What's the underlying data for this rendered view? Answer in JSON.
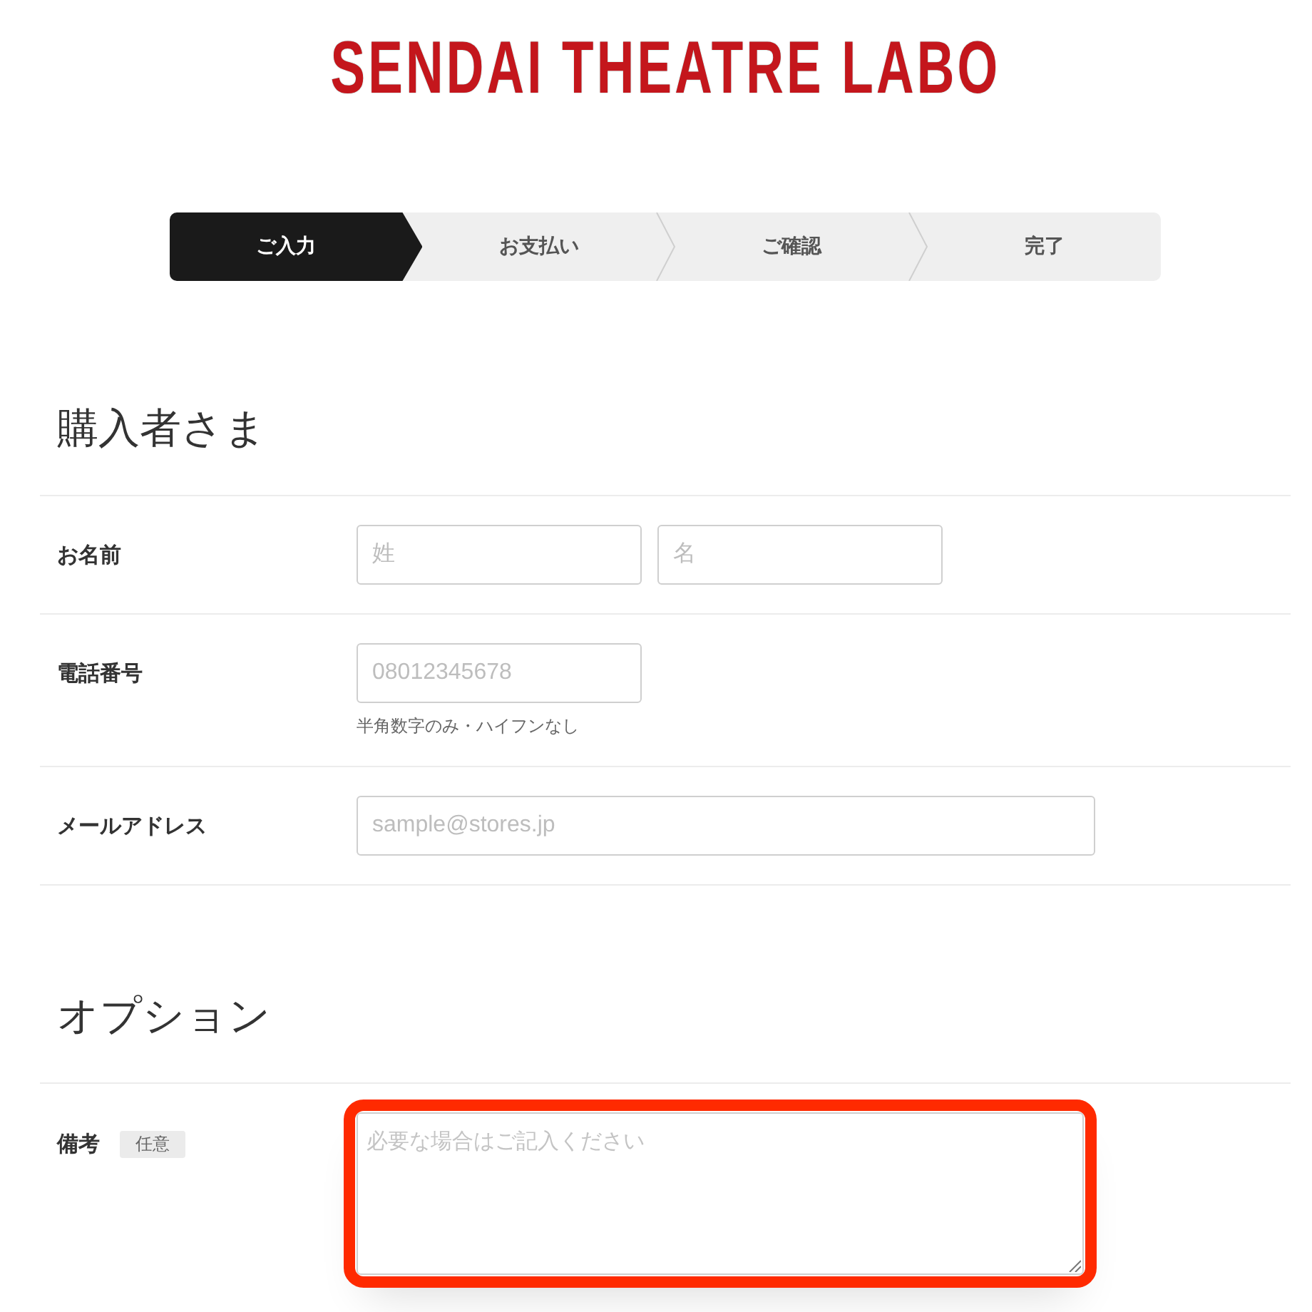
{
  "logo": {
    "text": "SENDAI THEATRE LABO"
  },
  "steps": [
    {
      "label": "ご入力",
      "selected": true
    },
    {
      "label": "お支払い",
      "selected": false
    },
    {
      "label": "ご確認",
      "selected": false
    },
    {
      "label": "完了",
      "selected": false
    }
  ],
  "sections": [
    {
      "title": "購入者さま",
      "fields": [
        {
          "label": "お名前",
          "inputs": [
            {
              "kind": "text",
              "placeholder": "姓"
            },
            {
              "kind": "text",
              "placeholder": "名"
            }
          ]
        },
        {
          "label": "電話番号",
          "inputs": [
            {
              "kind": "tel",
              "placeholder": "08012345678"
            }
          ],
          "hint": "半角数字のみ・ハイフンなし"
        },
        {
          "label": "メールアドレス",
          "inputs": [
            {
              "kind": "email",
              "placeholder": "sample@stores.jp"
            }
          ]
        }
      ]
    },
    {
      "title": "オプション",
      "fields": [
        {
          "label": "備考",
          "badge": "任意",
          "inputs": [
            {
              "kind": "textarea",
              "placeholder": "必要な場合はご記入ください",
              "highlighted": true
            }
          ]
        }
      ]
    }
  ]
}
